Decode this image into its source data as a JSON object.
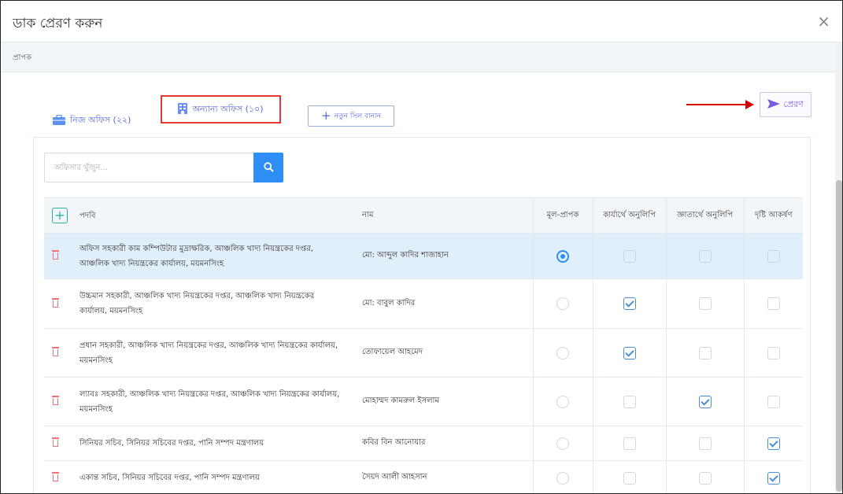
{
  "modal": {
    "title": "ডাক প্রেরণ করুন",
    "close_glyph": "×"
  },
  "section": {
    "label": "প্রাপক"
  },
  "tabs": [
    {
      "label": "নিজ অফিস (২২)",
      "icon": "briefcase-icon"
    },
    {
      "label": "অন্যান্য অফিস (১০)",
      "icon": "building-icon"
    }
  ],
  "new_seal_button": {
    "label": "নতুন সিল বানান",
    "icon": "plus-icon"
  },
  "send_button": {
    "label": "প্রেরণ",
    "icon": "send-icon"
  },
  "search": {
    "placeholder": "অফিসার খুঁজুন..."
  },
  "table": {
    "headers": {
      "designation": "পদবি",
      "name": "নাম",
      "main_recipient": "মূল-প্রাপক",
      "cc_action": "কার্যার্থে অনুলিপি",
      "cc_info": "জ্ঞাতার্থে অনুলিপি",
      "attention": "দৃষ্টি আকর্ষণ"
    },
    "rows": [
      {
        "designation": "অফিস সহকারী কাম কম্পিউটার মুদ্রাক্ষরিক, আঞ্চলিক খাদ্য নিয়ন্ত্রকের দপ্তর, আঞ্চলিক খাদ্য নিয়ন্ত্রকের কার্যালয়, ময়মনসিংহ",
        "name": "মো: আব্দুল কাদির শাজাহান",
        "main": true,
        "cc_action": false,
        "cc_info": false,
        "attention": false
      },
      {
        "designation": "উচ্চমান সহকারী, আঞ্চলিক খাদ্য নিয়ন্ত্রকের দপ্তর, আঞ্চলিক খাদ্য নিয়ন্ত্রকের কার্যালয়, ময়মনসিংহ",
        "name": "মো: বাবুল কাদির",
        "main": false,
        "cc_action": true,
        "cc_info": false,
        "attention": false
      },
      {
        "designation": "প্রধান সহকারী, আঞ্চলিক খাদ্য নিয়ন্ত্রকের দপ্তর, আঞ্চলিক খাদ্য নিয়ন্ত্রকের কার্যালয়, ময়মনসিংহ",
        "name": "তোফায়েল আহমেদ",
        "main": false,
        "cc_action": true,
        "cc_info": false,
        "attention": false
      },
      {
        "designation": "ল্যাবঃ সহকারী, আঞ্চলিক খাদ্য নিয়ন্ত্রকের দপ্তর, আঞ্চলিক খাদ্য নিয়ন্ত্রকের কার্যালয়, ময়মনসিংহ",
        "name": "মোহাম্মদ কামরুল ইসলাম",
        "main": false,
        "cc_action": false,
        "cc_info": true,
        "attention": false
      },
      {
        "designation": "সিনিয়র সচিব, সিনিয়র সচিবের দপ্তর, পানি সম্পদ মন্ত্রণালয়",
        "name": "কবির বিন আনোয়ার",
        "main": false,
        "cc_action": false,
        "cc_info": false,
        "attention": true
      },
      {
        "designation": "একান্ত সচিব, সিনিয়র সচিবের দপ্তর, পানি সম্পদ মন্ত্রণালয়",
        "name": "সৈয়দ আলী আহসান",
        "main": false,
        "cc_action": false,
        "cc_info": false,
        "attention": true
      }
    ]
  },
  "colors": {
    "accent": "#5867dd",
    "primary": "#2f8ef3",
    "annotation_red": "#e53935",
    "selected_row": "#e1effa",
    "delete": "#f1737a"
  }
}
